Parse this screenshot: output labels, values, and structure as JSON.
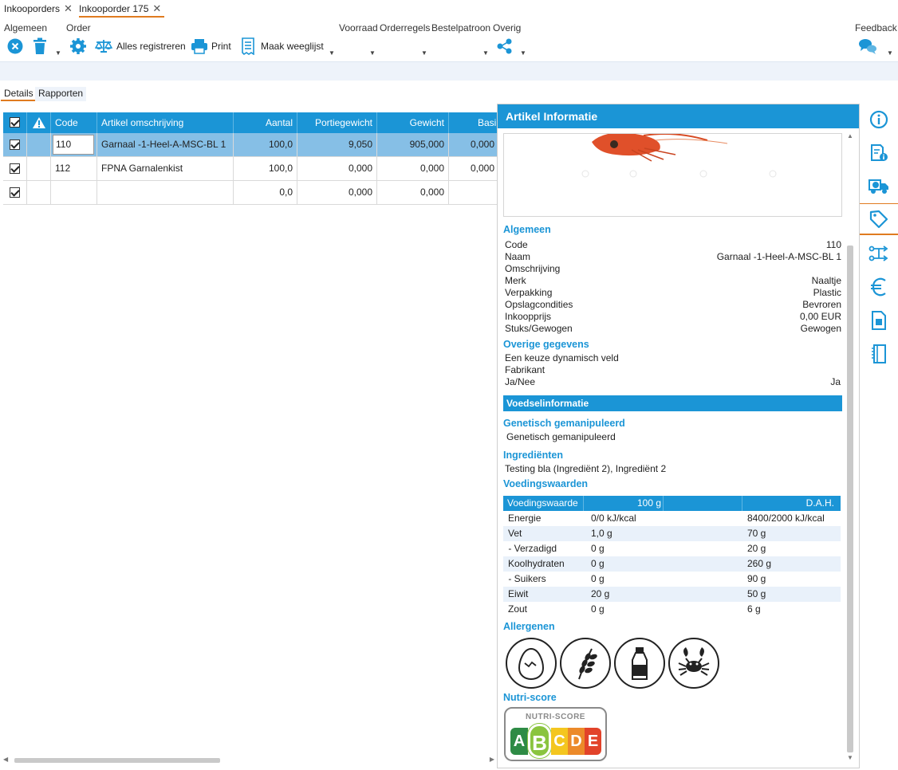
{
  "doc_tabs": [
    {
      "label": "Inkooporders"
    },
    {
      "label": "Inkooporder 175"
    }
  ],
  "ribbon": {
    "groups": {
      "algemeen": "Algemeen",
      "order": "Order",
      "voorraad": "Voorraad",
      "orderregels": "Orderregels",
      "bestelpatroon": "Bestelpatroon",
      "overig": "Overig",
      "feedback": "Feedback"
    },
    "buttons": {
      "alles_registreren": "Alles registreren",
      "print": "Print",
      "maak_weeglijst": "Maak weeglijst"
    }
  },
  "sub_tabs": [
    {
      "label": "Details"
    },
    {
      "label": "Rapporten"
    }
  ],
  "grid": {
    "columns": [
      "Code",
      "Artikel omschrijving",
      "Aantal",
      "Portiegewicht",
      "Gewicht",
      "Basi"
    ],
    "rows": [
      {
        "code": "110",
        "omschrijving": "Garnaal -1-Heel-A-MSC-BL 1",
        "aantal": "100,0",
        "portiegewicht": "9,050",
        "gewicht": "905,000",
        "basis": "0,000"
      },
      {
        "code": "112",
        "omschrijving": "FPNA Garnalenkist",
        "aantal": "100,0",
        "portiegewicht": "0,000",
        "gewicht": "0,000",
        "basis": "0,000"
      },
      {
        "code": "",
        "omschrijving": "",
        "aantal": "0,0",
        "portiegewicht": "0,000",
        "gewicht": "0,000",
        "basis": ""
      }
    ]
  },
  "panel": {
    "title": "Artikel Informatie",
    "algemeen": {
      "heading": "Algemeen",
      "items": [
        {
          "k": "Code",
          "v": "110"
        },
        {
          "k": "Naam",
          "v": "Garnaal -1-Heel-A-MSC-BL 1"
        },
        {
          "k": "Omschrijving",
          "v": ""
        },
        {
          "k": "Merk",
          "v": "Naaltje"
        },
        {
          "k": "Verpakking",
          "v": "Plastic"
        },
        {
          "k": "Opslagcondities",
          "v": "Bevroren"
        },
        {
          "k": "Inkoopprijs",
          "v": "0,00 EUR"
        },
        {
          "k": "Stuks/Gewogen",
          "v": "Gewogen"
        }
      ]
    },
    "overige": {
      "heading": "Overige gegevens",
      "items": [
        {
          "k": "Een keuze dynamisch veld",
          "v": ""
        },
        {
          "k": "Fabrikant",
          "v": ""
        },
        {
          "k": "Ja/Nee",
          "v": "Ja"
        }
      ]
    },
    "voedsel_bar": "Voedselinformatie",
    "genetisch": {
      "heading": "Genetisch gemanipuleerd",
      "value": "Genetisch gemanipuleerd"
    },
    "ingredienten": {
      "heading": "Ingrediënten",
      "value": "Testing bla (Ingrediënt 2), Ingrediënt 2"
    },
    "voedingswaarden": {
      "heading": "Voedingswaarden",
      "header": {
        "col1": "Voedingswaarde",
        "col2": "100 g",
        "col3": "D.A.H."
      },
      "rows": [
        {
          "name": "Energie",
          "per100": "0/0 kJ/kcal",
          "dah": "8400/2000 kJ/kcal"
        },
        {
          "name": "Vet",
          "per100": "1,0 g",
          "dah": "70 g"
        },
        {
          "name": " - Verzadigd",
          "per100": "0 g",
          "dah": "20 g"
        },
        {
          "name": "Koolhydraten",
          "per100": "0 g",
          "dah": "260 g"
        },
        {
          "name": " - Suikers",
          "per100": "0 g",
          "dah": "90 g"
        },
        {
          "name": "Eiwit",
          "per100": "20 g",
          "dah": "50 g"
        },
        {
          "name": "Zout",
          "per100": "0 g",
          "dah": "6 g"
        }
      ]
    },
    "allergenen": {
      "heading": "Allergenen",
      "icons": [
        "egg-icon",
        "gluten-icon",
        "milk-icon",
        "crustacean-icon"
      ]
    },
    "nutriscore": {
      "heading": "Nutri-score",
      "label": "NUTRI-SCORE",
      "letters": [
        "A",
        "B",
        "C",
        "D",
        "E"
      ],
      "selected": "B"
    }
  },
  "colors": {
    "accent": "#1b95d6",
    "tab_underline": "#e07b20"
  }
}
